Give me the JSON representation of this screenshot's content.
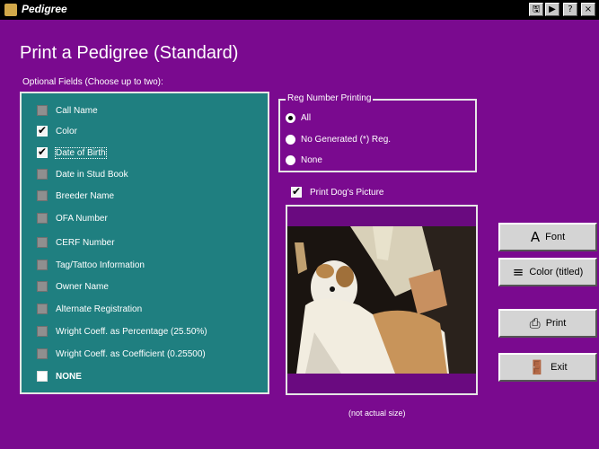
{
  "window": {
    "title": "Pedigree",
    "buttons": [
      "🖫",
      "▶",
      "?",
      "×"
    ]
  },
  "heading": "Print a Pedigree (Standard)",
  "optional_fields": {
    "label": "Optional Fields (Choose up to two):",
    "items": [
      {
        "label": "Call Name",
        "checked": false
      },
      {
        "label": "Color",
        "checked": true
      },
      {
        "label": "Date of Birth",
        "checked": true
      },
      {
        "label": "Date in Stud Book",
        "checked": false
      },
      {
        "label": "Breeder Name",
        "checked": false
      },
      {
        "label": "OFA Number",
        "checked": false
      },
      {
        "label": "CERF Number",
        "checked": false
      },
      {
        "label": "Tag/Tattoo Information",
        "checked": false
      },
      {
        "label": "Owner Name",
        "checked": false
      },
      {
        "label": "Alternate Registration",
        "checked": false
      },
      {
        "label": "Wright Coeff. as Percentage (25.50%)",
        "checked": false
      },
      {
        "label": "Wright Coeff. as Coefficient (0.25500)",
        "checked": false
      },
      {
        "label": "NONE",
        "checked": false
      }
    ]
  },
  "reg_number_printing": {
    "title": "Reg Number Printing",
    "options": [
      {
        "label": "All",
        "selected": true
      },
      {
        "label": "No Generated (*) Reg.",
        "selected": false
      },
      {
        "label": "None",
        "selected": false
      }
    ]
  },
  "print_dog_picture": {
    "label": "Print Dog's Picture",
    "checked": true
  },
  "picture_caption": "(not actual size)",
  "buttons": {
    "font": "Font",
    "color": "Color (titled)",
    "print": "Print",
    "exit": "Exit"
  }
}
